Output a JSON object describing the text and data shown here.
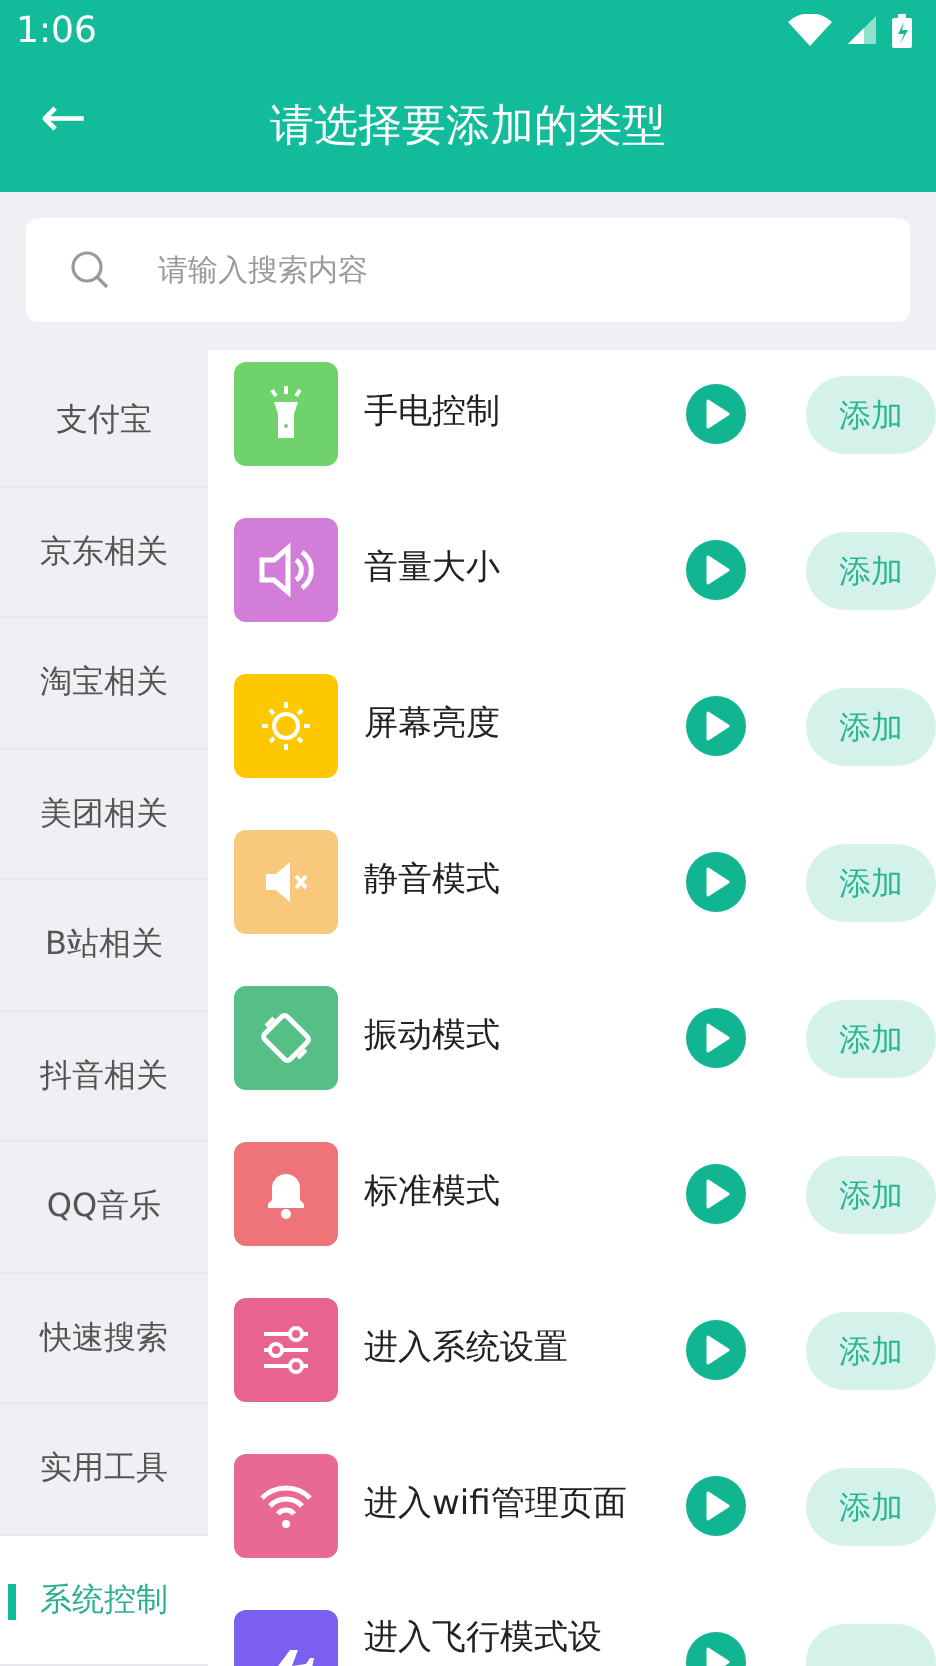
{
  "status_bar": {
    "time": "1:06"
  },
  "header": {
    "back": "←",
    "title": "请选择要添加的类型"
  },
  "search": {
    "placeholder": "请输入搜索内容"
  },
  "sidebar": {
    "items": [
      {
        "label": "支付宝",
        "selected": false
      },
      {
        "label": "京东相关",
        "selected": false
      },
      {
        "label": "淘宝相关",
        "selected": false
      },
      {
        "label": "美团相关",
        "selected": false
      },
      {
        "label": "B站相关",
        "selected": false
      },
      {
        "label": "抖音相关",
        "selected": false
      },
      {
        "label": "QQ音乐",
        "selected": false
      },
      {
        "label": "快速搜索",
        "selected": false
      },
      {
        "label": "实用工具",
        "selected": false
      },
      {
        "label": "系统控制",
        "selected": true
      }
    ]
  },
  "actions": [
    {
      "color": "#6fd26a",
      "label": "手电控制",
      "button": "添加"
    },
    {
      "color": "#d27ed8",
      "label": "音量大小",
      "button": "添加"
    },
    {
      "color": "#fdc800",
      "label": "屏幕亮度",
      "button": "添加"
    },
    {
      "color": "#f8c87c",
      "label": "静音模式",
      "button": "添加"
    },
    {
      "color": "#56bf86",
      "label": "振动模式",
      "button": "添加"
    },
    {
      "color": "#ef7479",
      "label": "标准模式",
      "button": "添加"
    },
    {
      "color": "#e8648f",
      "label": "进入系统设置",
      "button": "添加"
    },
    {
      "color": "#e86a92",
      "label": "进入wifi管理页面",
      "button": "添加"
    },
    {
      "color": "#7b5ff0",
      "label": "进入飞行模式设"
    }
  ]
}
